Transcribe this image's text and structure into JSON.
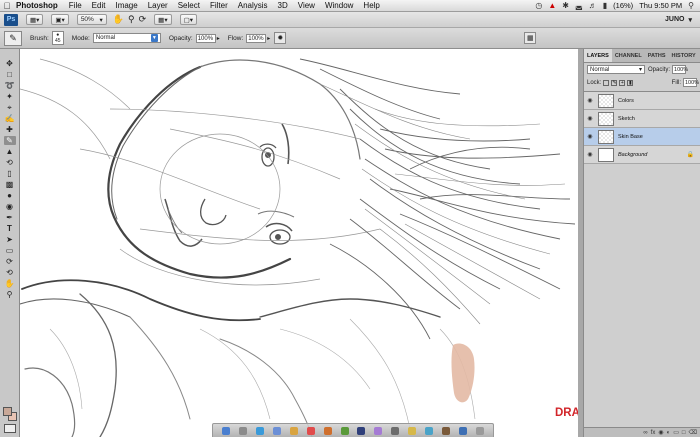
{
  "menubar": {
    "apple": "",
    "app_name": "Photoshop",
    "items": [
      "File",
      "Edit",
      "Image",
      "Layer",
      "Select",
      "Filter",
      "Analysis",
      "3D",
      "View",
      "Window",
      "Help"
    ],
    "battery": "(16%)",
    "clock": "Thu 9:50 PM"
  },
  "appbar": {
    "logo": "Ps",
    "zoom": "50%",
    "workspace": "JUNO"
  },
  "options": {
    "brush_label": "Brush:",
    "brush_size": "45",
    "mode_label": "Mode:",
    "mode_value": "Normal",
    "opacity_label": "Opacity:",
    "opacity_value": "100%",
    "flow_label": "Flow:",
    "flow_value": "100%"
  },
  "layers_panel": {
    "tabs": [
      "LAYERS",
      "CHANNEL",
      "PATHS",
      "HISTORY"
    ],
    "blend_mode": "Normal",
    "opacity_label": "Opacity:",
    "opacity_value": "100%",
    "lock_label": "Lock:",
    "fill_label": "Fill:",
    "fill_value": "100%",
    "layers": [
      {
        "name": "Colors",
        "selected": false
      },
      {
        "name": "Sketch",
        "selected": false
      },
      {
        "name": "Skin Base",
        "selected": true
      },
      {
        "name": "Background",
        "selected": false
      }
    ]
  },
  "colors": {
    "foreground": "#c9a898",
    "skin_stroke": "#e3b9a4",
    "selection": "#b7cdea"
  },
  "watermark": {
    "logo_text": "DRAWMASTER.RU"
  }
}
